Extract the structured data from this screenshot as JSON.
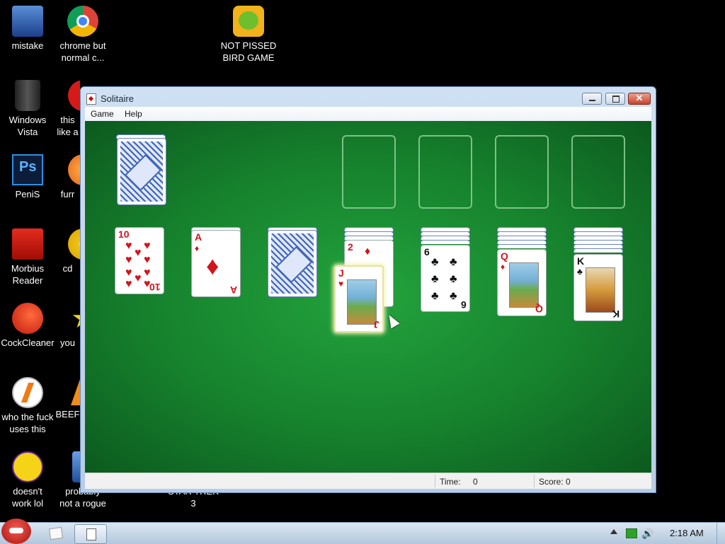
{
  "desktop_icons": [
    {
      "label": "mistake"
    },
    {
      "label": "chrome but\nnormal c..."
    },
    {
      "label": "NOT PISSED\nBIRD GAME"
    },
    {
      "label": "Windows\nVista"
    },
    {
      "label": "this\nlike a"
    },
    {
      "label": "PeniS"
    },
    {
      "label": "furr"
    },
    {
      "label": "Morbius\nReader"
    },
    {
      "label": "cd"
    },
    {
      "label": "CockCleaner"
    },
    {
      "label": "you"
    },
    {
      "label": "who the fuck\nuses this"
    },
    {
      "label": "BEEF"
    },
    {
      "label": "doesn't\nwork lol"
    },
    {
      "label": "probably\nnot a rogue"
    },
    {
      "label": "STAR TREK\n3"
    }
  ],
  "window": {
    "title": "Solitaire",
    "menu": [
      "Game",
      "Help"
    ],
    "status": {
      "time_label": "Time:",
      "time_value": "0",
      "score": "Score: 0"
    }
  },
  "cards": {
    "col1": {
      "rank": "10",
      "suit": "♥"
    },
    "col2": {
      "rank": "A",
      "suit": "♦"
    },
    "col4": {
      "rank": "2",
      "suit": "♦"
    },
    "col5": {
      "rank": "6",
      "suit": "♣"
    },
    "col6": {
      "rank": "Q",
      "suit": "♦"
    },
    "col7": {
      "rank": "K",
      "suit": "♣"
    },
    "dragged": {
      "rank": "J",
      "suit": "♥"
    }
  },
  "icons": {
    "ps_glyph": "Ps",
    "vol": "🔊",
    "close": "✕"
  },
  "taskbar": {
    "clock": "2:18 AM"
  }
}
